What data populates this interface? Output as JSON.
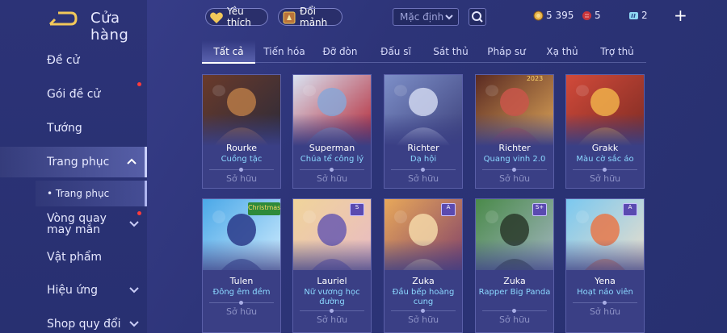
{
  "header": {
    "title": "Cửa hàng"
  },
  "sidebar": {
    "items": [
      {
        "label": "Đề cử"
      },
      {
        "label": "Gói đề cử"
      },
      {
        "label": "Tướng"
      },
      {
        "label": "Trang phục"
      },
      {
        "label": "Vòng quay may mắn"
      },
      {
        "label": "Vật phẩm"
      },
      {
        "label": "Hiệu ứng"
      },
      {
        "label": "Shop quy đổi"
      }
    ],
    "sub_item": "• Trang phục"
  },
  "topbar": {
    "favorite_label": "Yêu thích",
    "exchange_label": "Đổi mảnh",
    "sort_value": "Mặc định",
    "gold": "5 395",
    "gems": "5",
    "vouchers": "2"
  },
  "tabs": [
    "Tất cả",
    "Tiến hóa",
    "Đỡ đòn",
    "Đấu sĩ",
    "Sát thủ",
    "Pháp sư",
    "Xạ thủ",
    "Trợ thủ"
  ],
  "cards": [
    {
      "hero": "Rourke",
      "skin": "Cuồng tặc",
      "status": "Sở hữu",
      "colors": [
        "#6a3a2a",
        "#b77a46",
        "#2a2a3a"
      ]
    },
    {
      "hero": "Superman",
      "skin": "Chúa tể công lý",
      "status": "Sở hữu",
      "colors": [
        "#d9e3f2",
        "#8aa6d6",
        "#b2202f"
      ]
    },
    {
      "hero": "Richter",
      "skin": "Dạ hội",
      "status": "Sở hữu",
      "colors": [
        "#7d8fc8",
        "#cfd6ef",
        "#3b3f7a"
      ]
    },
    {
      "hero": "Richter",
      "skin": "Quang vinh 2.0",
      "status": "Sở hữu",
      "badge_text": "2023",
      "colors": [
        "#5a2a22",
        "#c9564a",
        "#e0a85a"
      ]
    },
    {
      "hero": "Grakk",
      "skin": "Màu cờ sắc áo",
      "status": "Sở hữu",
      "colors": [
        "#d24a3a",
        "#f0b04a",
        "#7a2a22"
      ]
    },
    {
      "hero": "Tulen",
      "skin": "Đông êm đềm",
      "status": "Sở hữu",
      "badge_text": "Christmas",
      "colors": [
        "#4aa8e8",
        "#2a3a8a",
        "#d8f0ff"
      ]
    },
    {
      "hero": "Lauriel",
      "skin": "Nữ vương học đường",
      "status": "Sở hữu",
      "badge_text": "S",
      "colors": [
        "#f0d49a",
        "#6a5ab0",
        "#e8b8c8"
      ]
    },
    {
      "hero": "Zuka",
      "skin": "Đầu bếp hoàng cung",
      "status": "Sở hữu",
      "badge_text": "A",
      "colors": [
        "#e8a85a",
        "#f4d8a8",
        "#7a3a6a"
      ]
    },
    {
      "hero": "Zuka",
      "skin": "Rapper Big Panda",
      "status": "Sở hữu",
      "badge_text": "S+",
      "colors": [
        "#4a8a4a",
        "#2a3a2a",
        "#a8b8c8"
      ]
    },
    {
      "hero": "Yena",
      "skin": "Hoạt náo viên",
      "status": "Sở hữu",
      "badge_text": "A",
      "colors": [
        "#7ac8f0",
        "#e8784a",
        "#f4e0c8"
      ]
    }
  ]
}
